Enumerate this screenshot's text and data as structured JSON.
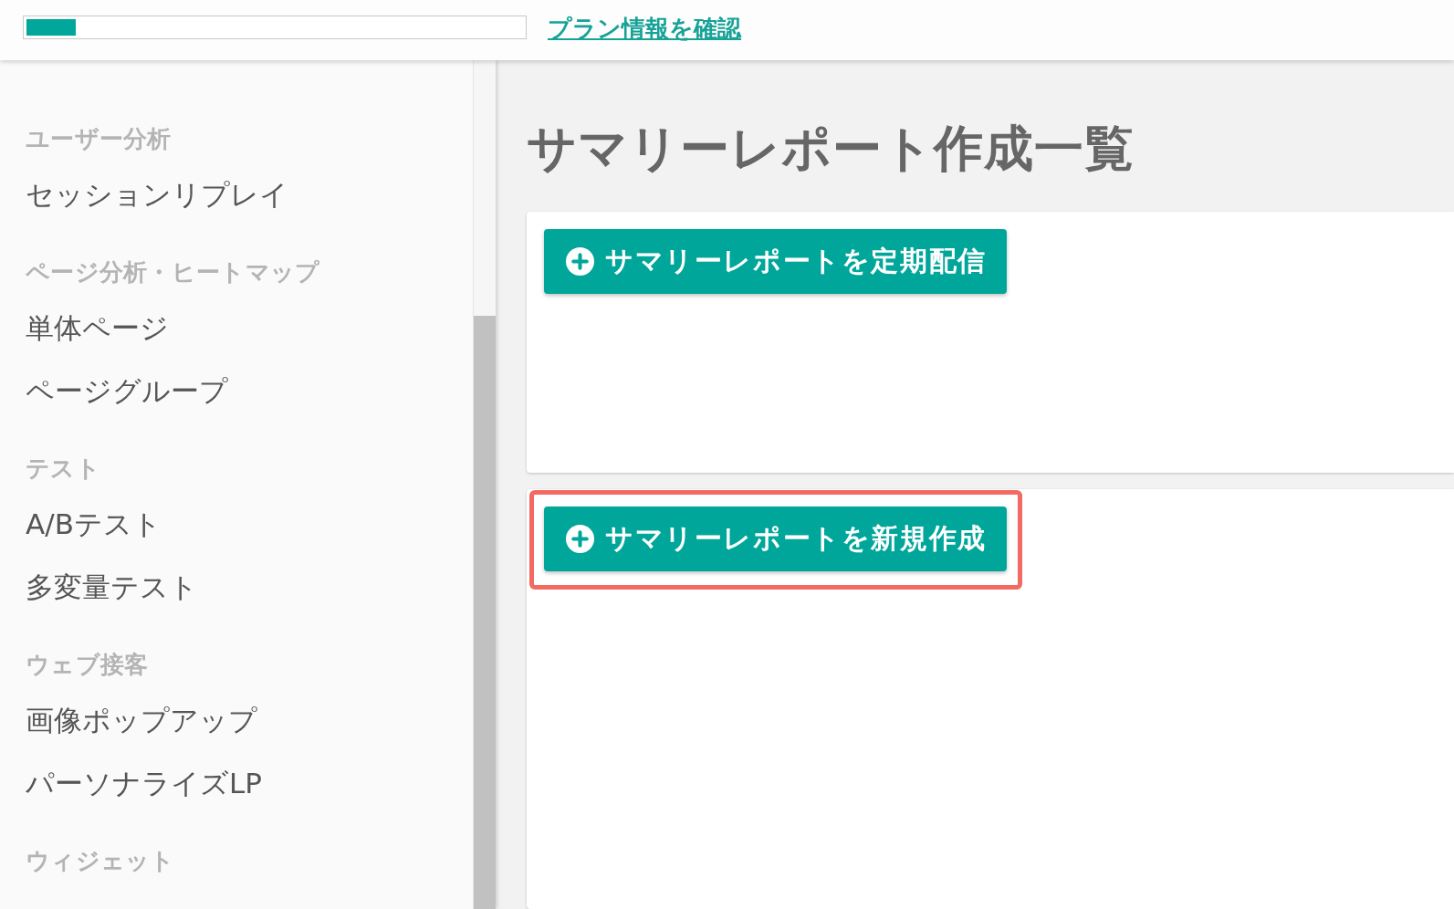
{
  "top_bar": {
    "usage_meter": {
      "level": 0.1
    },
    "plan_link": "プラン情報を確認"
  },
  "sidebar": {
    "sections": [
      {
        "heading": "ユーザー分析",
        "items": [
          "セッションリプレイ"
        ]
      },
      {
        "heading": "ページ分析・ヒートマップ",
        "items": [
          "単体ページ",
          "ページグループ"
        ]
      },
      {
        "heading": "テスト",
        "items": [
          "A/Bテスト",
          "多変量テスト"
        ]
      },
      {
        "heading": "ウェブ接客",
        "items": [
          "画像ポップアップ",
          "パーソナライズLP"
        ]
      },
      {
        "heading": "ウィジェット"
      }
    ]
  },
  "main": {
    "title": "サマリーレポート作成一覧",
    "cards": [
      {
        "button": "サマリーレポートを定期配信",
        "highlighted": false
      },
      {
        "button": "サマリーレポートを新規作成",
        "highlighted": true
      }
    ]
  }
}
